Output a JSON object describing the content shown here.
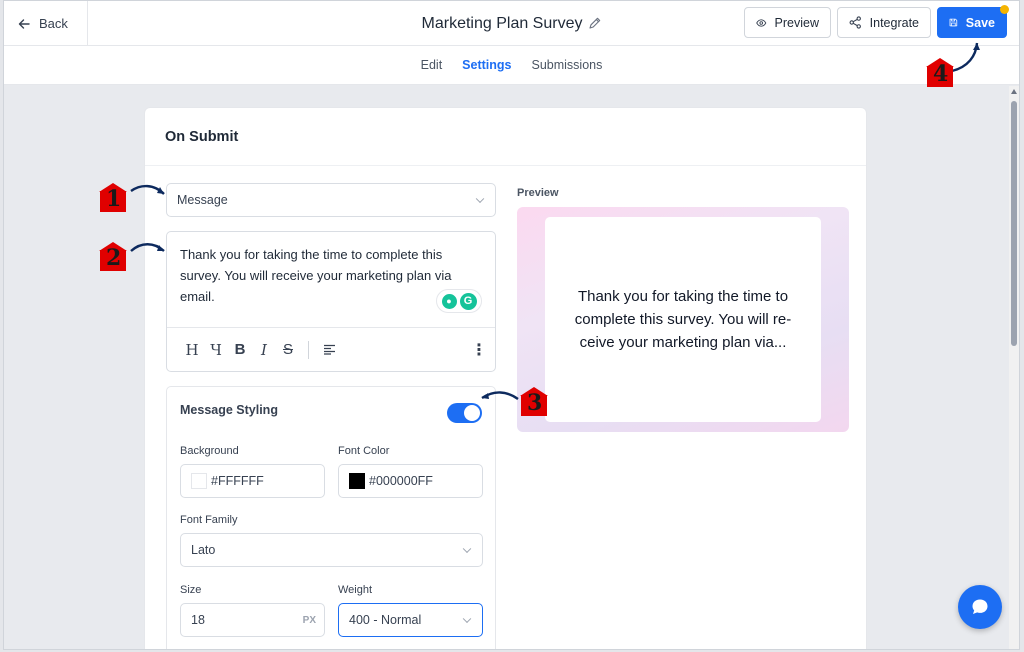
{
  "header": {
    "back_label": "Back",
    "title": "Marketing Plan Survey",
    "preview_label": "Preview",
    "integrate_label": "Integrate",
    "save_label": "Save"
  },
  "tabs": [
    {
      "label": "Edit",
      "active": false
    },
    {
      "label": "Settings",
      "active": true
    },
    {
      "label": "Submissions",
      "active": false
    }
  ],
  "section": {
    "title": "On Submit",
    "action_select": "Message",
    "message_text": "Thank you for taking the time to complete this survey. You will receive your marketing plan via email.",
    "toolbar_icons": [
      "heading-icon",
      "paragraph-icon",
      "bold-icon",
      "italic-icon",
      "strikethrough-icon",
      "align-left-icon",
      "more-vertical-icon"
    ]
  },
  "styling": {
    "title": "Message Styling",
    "enabled": true,
    "background_label": "Background",
    "background_value": "#FFFFFF",
    "font_color_label": "Font Color",
    "font_color_value": "#000000FF",
    "font_family_label": "Font Family",
    "font_family_value": "Lato",
    "size_label": "Size",
    "size_value": "18",
    "size_unit": "PX",
    "weight_label": "Weight",
    "weight_value": "400 - Normal"
  },
  "preview": {
    "label": "Preview",
    "text": "Thank you for taking the time to complete this survey. You will re-ceive your marketing plan via..."
  },
  "annotations": [
    "1",
    "2",
    "3",
    "4"
  ],
  "colors": {
    "accent": "#1d6ef3",
    "annotation_marker": "#e00000",
    "annotation_arrow": "#0d2a5e"
  }
}
